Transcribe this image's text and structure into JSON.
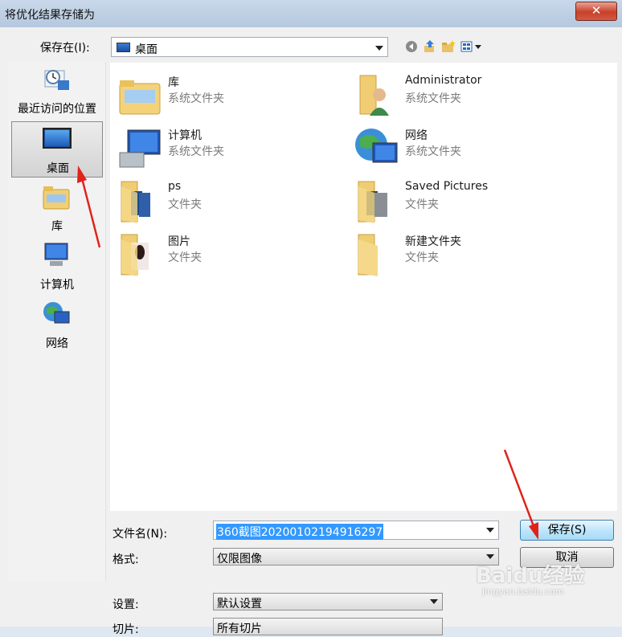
{
  "window": {
    "title": "将优化结果存储为",
    "close_glyph": "✕"
  },
  "toolbar": {
    "save_in_label": "保存在(I):",
    "location": "桌面",
    "back_icon": "back-icon",
    "up_icon": "up-folder-icon",
    "new_folder_icon": "new-folder-icon",
    "view_menu_icon": "view-menu-icon"
  },
  "places": [
    {
      "label": "最近访问的位置",
      "icon": "recent-places-icon",
      "selected": false
    },
    {
      "label": "桌面",
      "icon": "desktop-icon",
      "selected": true
    },
    {
      "label": "库",
      "icon": "library-icon",
      "selected": false
    },
    {
      "label": "计算机",
      "icon": "computer-icon",
      "selected": false
    },
    {
      "label": "网络",
      "icon": "network-icon",
      "selected": false
    }
  ],
  "files": [
    {
      "name": "库",
      "type": "系统文件夹",
      "icon": "library-folder-icon"
    },
    {
      "name": "Administrator",
      "type": "系统文件夹",
      "icon": "user-folder-icon"
    },
    {
      "name": "计算机",
      "type": "系统文件夹",
      "icon": "computer-icon"
    },
    {
      "name": "网络",
      "type": "系统文件夹",
      "icon": "network-icon"
    },
    {
      "name": "ps",
      "type": "文件夹",
      "icon": "folder-icon"
    },
    {
      "name": "Saved Pictures",
      "type": "文件夹",
      "icon": "folder-icon"
    },
    {
      "name": "图片",
      "type": "文件夹",
      "icon": "pictures-folder-icon"
    },
    {
      "name": "新建文件夹",
      "type": "文件夹",
      "icon": "folder-icon"
    }
  ],
  "form": {
    "filename_label": "文件名(N):",
    "filename_value": "360截图20200102194916297",
    "format_label": "格式:",
    "format_value": "仅限图像",
    "settings_label": "设置:",
    "settings_value": "默认设置",
    "slices_label": "切片:",
    "slices_value": "所有切片",
    "save_button": "保存(S)",
    "cancel_button": "取消"
  },
  "watermark": {
    "text": "Baidu经验",
    "url": "jingyan.baidu.com"
  },
  "colors": {
    "accent_arrow": "#e0231b",
    "selection": "#3399ff"
  }
}
